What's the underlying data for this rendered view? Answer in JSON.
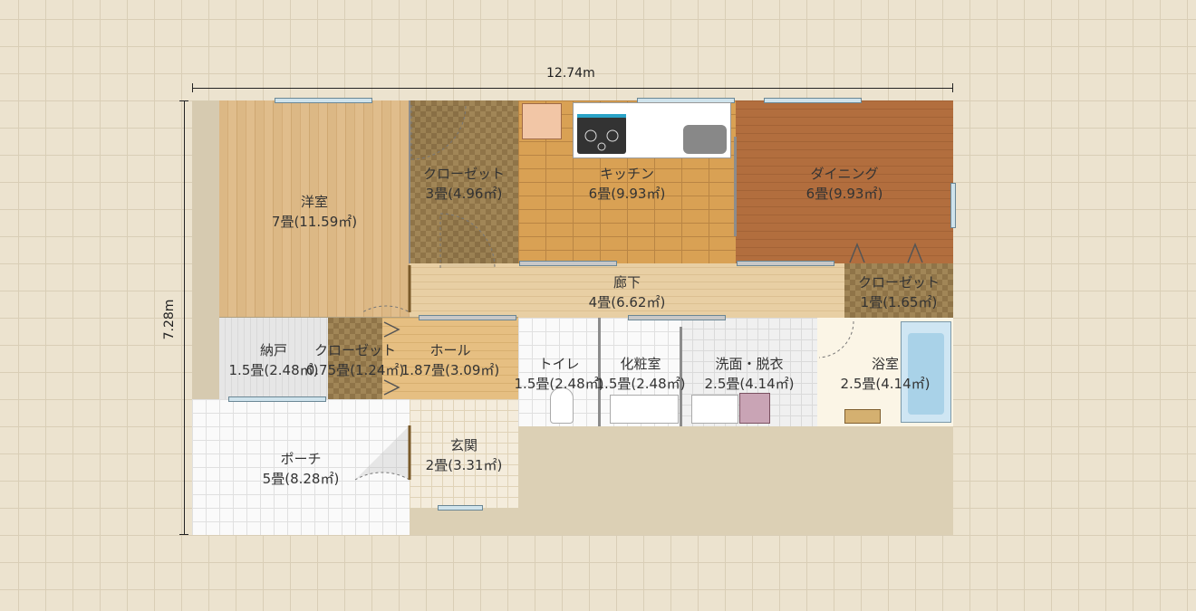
{
  "dimensions": {
    "width_label": "12.74m",
    "height_label": "7.28m"
  },
  "rooms": {
    "youshitsu": {
      "name": "洋室",
      "size": "7畳(11.59㎡)"
    },
    "closet_main": {
      "name": "クローゼット",
      "size": "3畳(4.96㎡)"
    },
    "kitchen": {
      "name": "キッチン",
      "size": "6畳(9.93㎡)"
    },
    "dining": {
      "name": "ダイニング",
      "size": "6畳(9.93㎡)"
    },
    "corridor": {
      "name": "廊下",
      "size": "4畳(6.62㎡)"
    },
    "closet_right": {
      "name": "クローゼット",
      "size": "1畳(1.65㎡)"
    },
    "nando": {
      "name": "納戸",
      "size": "1.5畳(2.48㎡)"
    },
    "closet_small": {
      "name": "クローゼット",
      "size": "0.75畳(1.24㎡)"
    },
    "hall": {
      "name": "ホール",
      "size": "1.87畳(3.09㎡)"
    },
    "toilet": {
      "name": "トイレ",
      "size": "1.5畳(2.48㎡)"
    },
    "powder_room": {
      "name": "化粧室",
      "size": "1.5畳(2.48㎡)"
    },
    "washroom": {
      "name": "洗面・脱衣",
      "size": "2.5畳(4.14㎡)"
    },
    "bathroom": {
      "name": "浴室",
      "size": "2.5畳(4.14㎡)"
    },
    "porch": {
      "name": "ポーチ",
      "size": "5畳(8.28㎡)"
    },
    "entrance": {
      "name": "玄関",
      "size": "2畳(3.31㎡)"
    }
  }
}
